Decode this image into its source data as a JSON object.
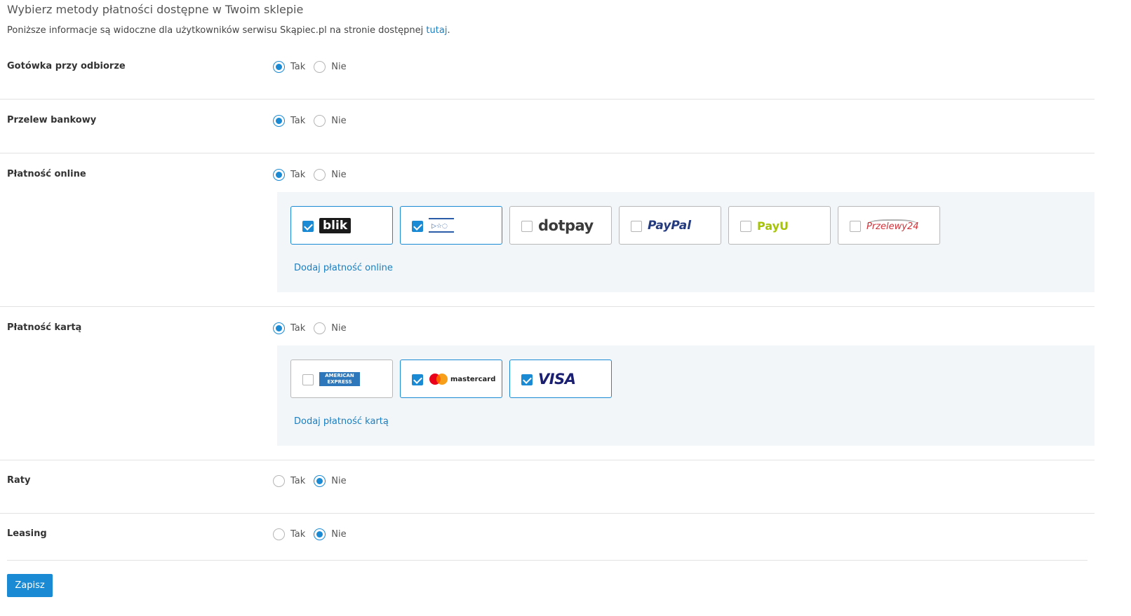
{
  "header": {
    "title": "Wybierz metody płatności dostępne w Twoim sklepie",
    "intro_text": "Poniższe informacje są widoczne dla użytkowników serwisu Skąpiec.pl na stronie dostępnej ",
    "intro_link": "tutaj",
    "intro_end": "."
  },
  "options": {
    "yes": "Tak",
    "no": "Nie"
  },
  "methods": {
    "cash": {
      "label": "Gotówka przy odbiorze",
      "selected": "Tak"
    },
    "transfer": {
      "label": "Przelew bankowy",
      "selected": "Tak"
    },
    "online": {
      "label": "Płatność online",
      "selected": "Tak",
      "add_link": "Dodaj płatność online"
    },
    "card": {
      "label": "Płatność kartą",
      "selected": "Tak",
      "add_link": "Dodaj płatność kartą"
    },
    "installments": {
      "label": "Raty",
      "selected": "Nie"
    },
    "leasing": {
      "label": "Leasing",
      "selected": "Nie"
    }
  },
  "online_providers": [
    {
      "name": "blik",
      "logo_text": "blik",
      "checked": true
    },
    {
      "name": "bank-logo",
      "logo_text": "",
      "checked": true
    },
    {
      "name": "dotpay",
      "logo_text": "dotpay",
      "checked": false
    },
    {
      "name": "paypal",
      "logo_text": "PayPal",
      "checked": false
    },
    {
      "name": "payu",
      "logo_text": "PayU",
      "checked": false
    },
    {
      "name": "przelewy24",
      "logo_text": "Przelewy24",
      "checked": false
    }
  ],
  "card_providers": [
    {
      "name": "american-express",
      "logo_text": "AMERICAN EXPRESS",
      "checked": false
    },
    {
      "name": "mastercard",
      "logo_text": "mastercard",
      "checked": true
    },
    {
      "name": "visa",
      "logo_text": "VISA",
      "checked": true
    }
  ],
  "save_button": "Zapisz",
  "colors": {
    "accent": "#1a8ad4",
    "link": "#1a7fc1",
    "panel_bg": "#f2f6f9",
    "divider": "#e2e2e2"
  }
}
